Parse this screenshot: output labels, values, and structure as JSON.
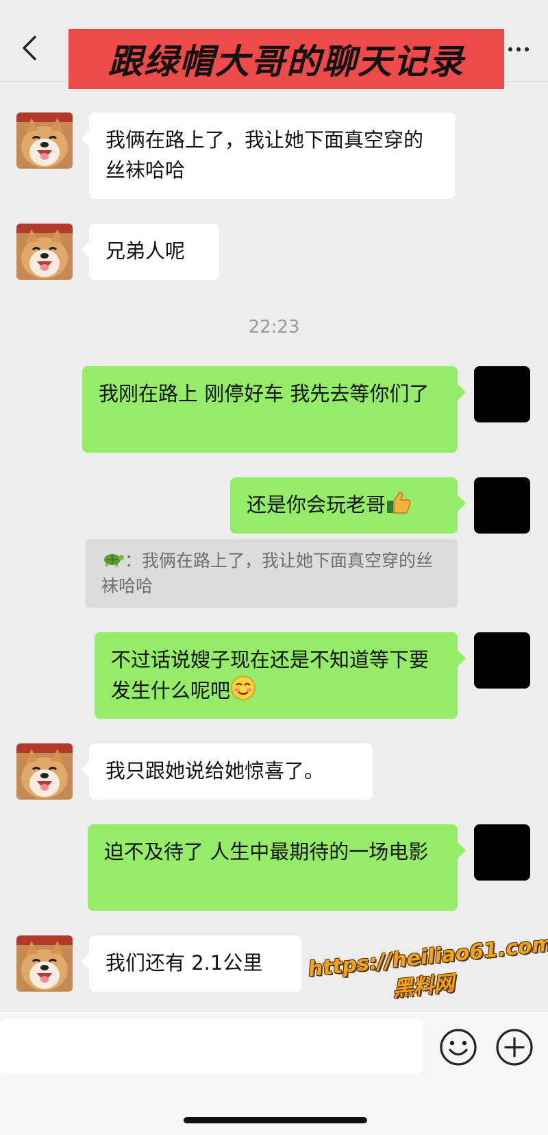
{
  "header": {
    "title": "跟绿帽大哥的聊天记录"
  },
  "messages": [
    {
      "side": "in",
      "text": "我俩在路上了，我让她下面真空穿的丝袜哈哈"
    },
    {
      "side": "in",
      "text": "兄弟人呢"
    },
    {
      "timestamp": "22:23"
    },
    {
      "side": "out",
      "text": "我刚在路上 刚停好车 我先去等你们了"
    },
    {
      "side": "out",
      "text": "还是你会玩老哥",
      "emoji": "thumbs-up"
    },
    {
      "quote": {
        "sender_icon": "turtle",
        "text": "：我俩在路上了，我让她下面真空穿的丝袜哈哈"
      }
    },
    {
      "side": "out",
      "text": "不过话说嫂子现在还是不知道等下要发生什么呢吧",
      "emoji": "smiling-face"
    },
    {
      "side": "in",
      "text": "我只跟她说给她惊喜了。"
    },
    {
      "side": "out",
      "text": "迫不及待了 人生中最期待的一场电影"
    },
    {
      "side": "in",
      "text": "我们还有 2.1公里"
    }
  ],
  "watermark": {
    "line1": "https://heiliao61.com",
    "line2": "黑料网"
  },
  "colors": {
    "background": "#ededed",
    "outgoing_bubble": "#95ec69",
    "incoming_bubble": "#ffffff",
    "title_banner": "#ee4a4a",
    "watermark": "#f0a41c"
  }
}
